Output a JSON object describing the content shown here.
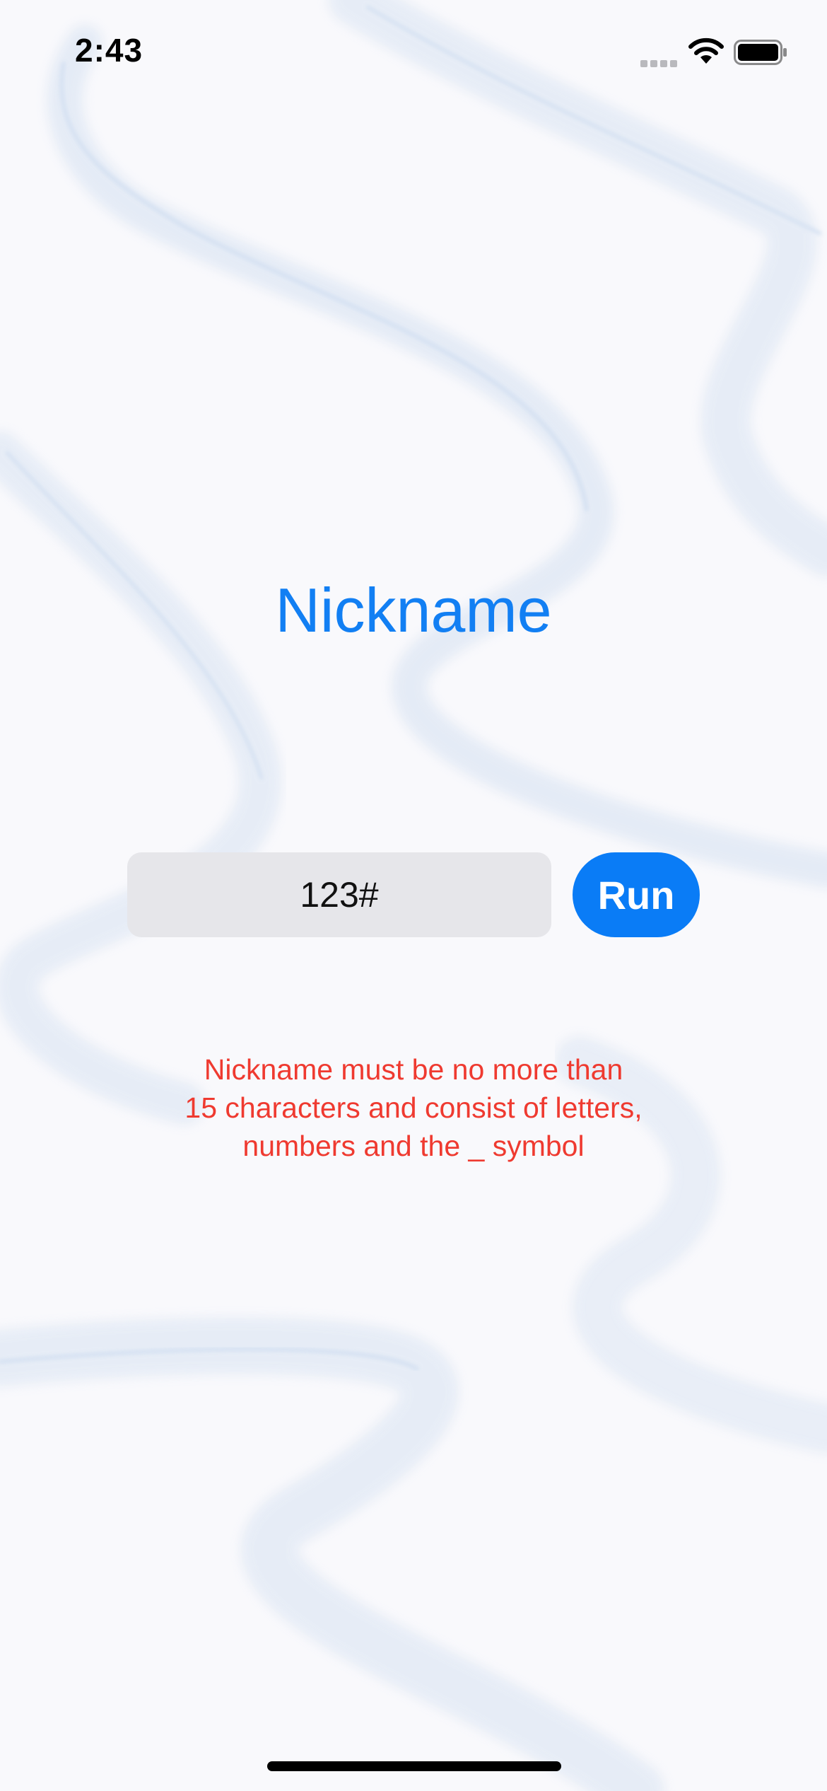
{
  "status_bar": {
    "time": "2:43"
  },
  "screen": {
    "title": "Nickname",
    "nickname_input": {
      "value": "123#",
      "placeholder": ""
    },
    "run_button_label": "Run",
    "error_lines": [
      "Nickname must be no more than",
      "15 characters and consist of letters,",
      "numbers and the _ symbol"
    ]
  },
  "colors": {
    "accent": "#0a7cf6",
    "title": "#127ff3",
    "error": "#ef3a30",
    "field_background": "#e6e6ea",
    "background": "#f9f9fc"
  },
  "icons": [
    "cellular-signal-icon",
    "wifi-icon",
    "battery-icon"
  ]
}
